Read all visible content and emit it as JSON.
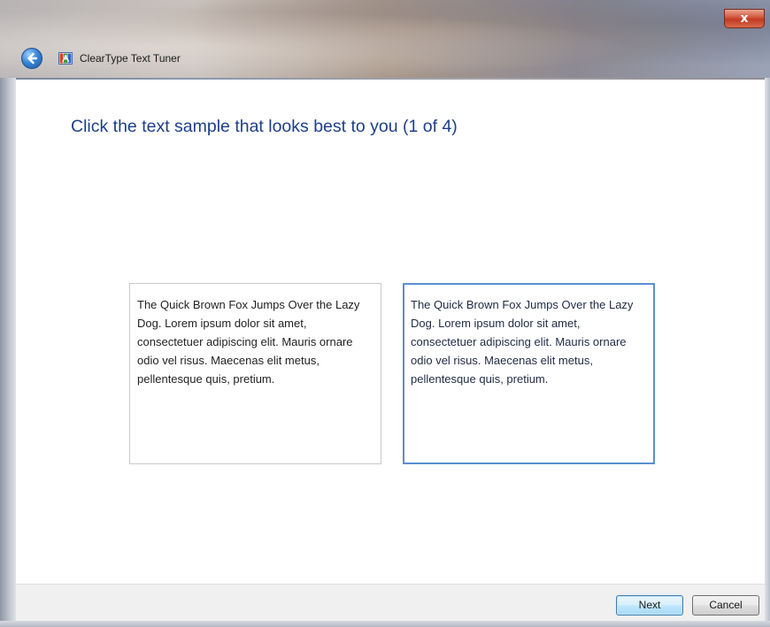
{
  "window": {
    "title": "ClearType Text Tuner",
    "close_label": "x",
    "colors": {
      "heading": "#1e3f8a",
      "selected_border": "#5a8fcf",
      "close_button": "#c13a22"
    }
  },
  "main": {
    "heading": "Click the text sample that looks best to you (1 of 4)",
    "samples": [
      {
        "text": "The Quick Brown Fox Jumps Over the Lazy Dog. Lorem ipsum dolor sit amet, consectetuer adipiscing elit. Mauris ornare odio vel risus. Maecenas elit metus, pellentesque quis, pretium.",
        "selected": false
      },
      {
        "text": "The Quick Brown Fox Jumps Over the Lazy Dog. Lorem ipsum dolor sit amet, consectetuer adipiscing elit. Mauris ornare odio vel risus. Maecenas elit metus, pellentesque quis, pretium.",
        "selected": true
      }
    ]
  },
  "footer": {
    "next_label": "Next",
    "cancel_label": "Cancel"
  },
  "icons": {
    "back": "back-arrow-icon",
    "app": "cleartype-icon",
    "close": "close-icon"
  }
}
